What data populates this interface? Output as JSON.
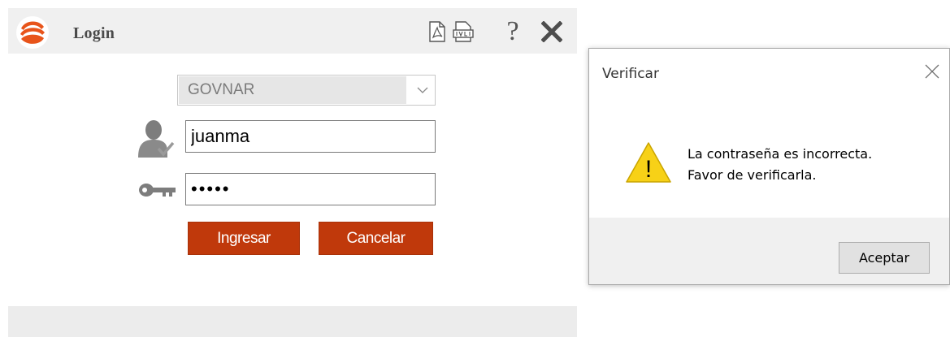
{
  "login": {
    "title": "Login",
    "environment_select": {
      "value": "GOVNAR"
    },
    "username": {
      "value": "juanma"
    },
    "password": {
      "value": "•••••"
    },
    "buttons": {
      "ingresar": "Ingresar",
      "cancelar": "Cancelar"
    },
    "toolbar_icons": [
      "pdf-icon",
      "document-icon",
      "help-icon",
      "close-icon"
    ],
    "help_glyph": "?",
    "colors": {
      "button": "#c0390b",
      "logo": "#e8541a"
    }
  },
  "dialog": {
    "title": "Verificar",
    "message_lines": [
      "La contraseña es incorrecta.",
      "Favor de verificarla."
    ],
    "warning_glyph": "!",
    "ok_button": "Aceptar",
    "colors": {
      "warning": "#f7d117"
    }
  }
}
